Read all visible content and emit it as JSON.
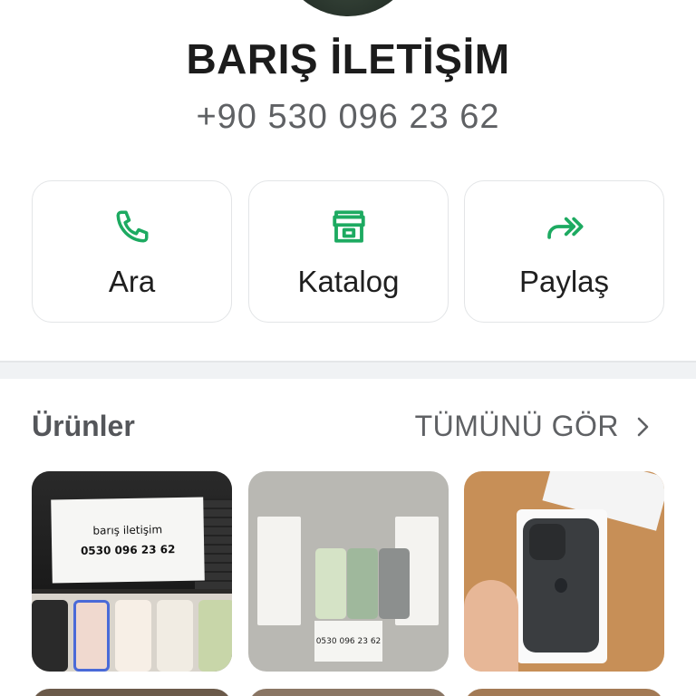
{
  "profile": {
    "name": "BARIŞ İLETİŞİM",
    "phone": "+90 530 096 23 62"
  },
  "actions": [
    {
      "label": "Ara",
      "icon": "phone-icon"
    },
    {
      "label": "Katalog",
      "icon": "storefront-icon"
    },
    {
      "label": "Paylaş",
      "icon": "share-forward-icon"
    }
  ],
  "products_section": {
    "title": "Ürünler",
    "see_all_label": "TÜMÜNÜ GÖR",
    "see_all_icon": "chevron-right-icon"
  },
  "product_images": {
    "p0_paper_line1": "barış iletişim",
    "p0_paper_line2": "0530 096 23 62",
    "p1_note": "0530 096 23 62"
  },
  "colors": {
    "accent": "#1daa61",
    "card_border": "#e3e5e7",
    "divider": "#f0f2f4"
  }
}
